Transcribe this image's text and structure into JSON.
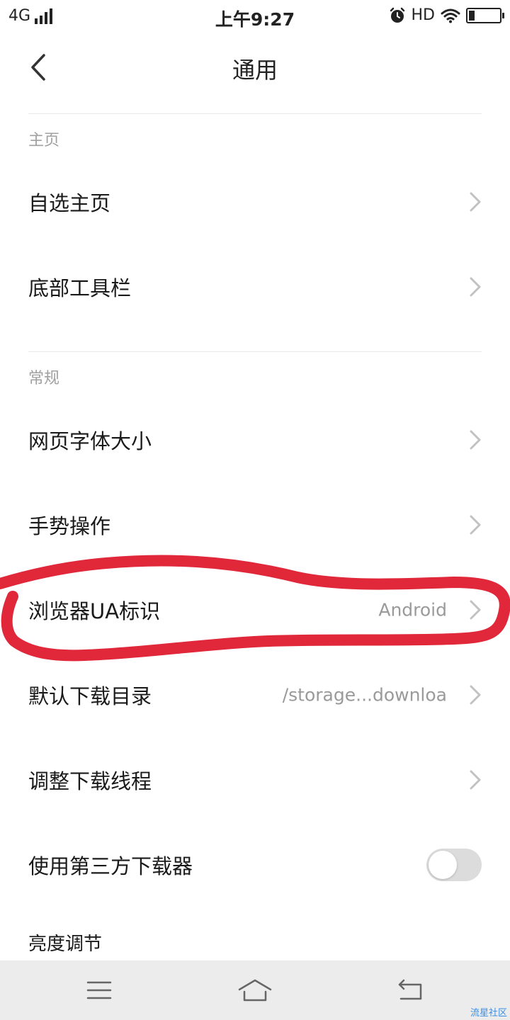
{
  "status_bar": {
    "network": "4G",
    "time": "上午9:27",
    "hd": "HD",
    "icons": [
      "signal-icon",
      "alarm-icon",
      "wifi-icon",
      "battery-icon"
    ]
  },
  "header": {
    "title": "通用",
    "back_icon": "chevron-left-icon"
  },
  "sections": {
    "home": {
      "title": "主页"
    },
    "general": {
      "title": "常规"
    }
  },
  "rows": {
    "custom_home": {
      "label": "自选主页"
    },
    "bottom_toolbar": {
      "label": "底部工具栏"
    },
    "font_size": {
      "label": "网页字体大小"
    },
    "gestures": {
      "label": "手势操作"
    },
    "ua": {
      "label": "浏览器UA标识",
      "value": "Android"
    },
    "download_dir": {
      "label": "默认下载目录",
      "value": "/storage...downloa"
    },
    "download_threads": {
      "label": "调整下载线程"
    },
    "third_party_downloader": {
      "label": "使用第三方下载器",
      "toggle_on": false
    },
    "brightness": {
      "label": "亮度调节"
    }
  },
  "nav_bar": {
    "icons": [
      "menu-icon",
      "home-icon",
      "back-icon"
    ]
  },
  "watermark": "流星社区",
  "colors": {
    "annotation_red": "#e0283a",
    "section_gray": "#a0a0a0",
    "value_gray": "#9a9a9a",
    "toggle_off": "#dcdcdc",
    "nav_bg": "#ececec"
  }
}
